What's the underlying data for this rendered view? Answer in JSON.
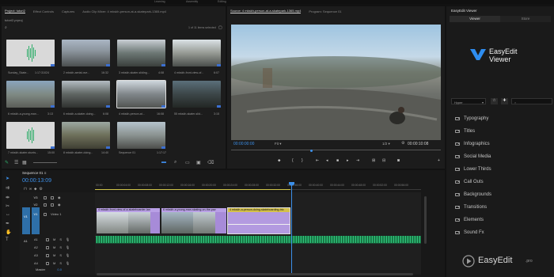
{
  "menubar": [
    "Learning",
    "Assembly",
    "Editing",
    "Color",
    "Effects"
  ],
  "project_panel": {
    "tabs": [
      "Project: tutori2",
      "Effect Controls",
      "Captures",
      "Audio Clip Mixer: 4 mkskh-person-at-a-skatepark-1365.mp4"
    ],
    "bin": "tutori2.prproj",
    "items_selected": "1 of 11 items selected",
    "items": [
      {
        "name": "Sunday_Skate...",
        "dur": "1:17:31024",
        "kind": "audio"
      },
      {
        "name": "2 mkskh-aerial-ove...",
        "dur": "16:32",
        "kind": "video"
      },
      {
        "name": "3 mkskh-skater-sliding...",
        "dur": "4:08",
        "kind": "video"
      },
      {
        "name": "4 mkskh-front-view-of...",
        "dur": "6:07",
        "kind": "video"
      },
      {
        "name": "6 mkskh-a-young-man...",
        "dur": "3:13",
        "kind": "video"
      },
      {
        "name": "6 mkskh-a-skater-doing...",
        "dur": "6:08",
        "kind": "video"
      },
      {
        "name": "4 mkskh-person-at...",
        "dur": "16:08",
        "kind": "video"
      },
      {
        "name": "55 mkskh-skater-slid...",
        "dur": "3:15",
        "kind": "video"
      },
      {
        "name": "7 mkskh-skater-stunts...",
        "dur": "15:00",
        "kind": "audio"
      },
      {
        "name": "8 mkskh-skater-doing...",
        "dur": "14:40",
        "kind": "video"
      },
      {
        "name": "Sequence 01",
        "dur": "1:17:17",
        "kind": "video"
      }
    ]
  },
  "source_monitor": {
    "tabs": [
      "Source: 4 mkskh-person-at-a-skatepark-1365.mp4",
      "Program: Sequence 01"
    ],
    "timecode_in": "00:00:00:00",
    "fit": "Fit",
    "quality": "1/2",
    "timecode_out": "00:00:10:08"
  },
  "timeline": {
    "sequence_tab": "Sequence 01",
    "timecode": "00:00:13:09",
    "ruler": [
      "00:00",
      "00:00:04:00",
      "00:00:08:00",
      "00:00:12:00",
      "00:00:16:00",
      "00:00:20:00",
      "00:00:24:00",
      "00:00:28:00",
      "00:00:32:00",
      "00:00:36:00",
      "00:00:40:00",
      "00:00:44:00",
      "00:00:48:00",
      "00:00:52:00",
      "00:00:56:00"
    ],
    "video_tracks": [
      "V3",
      "V2",
      "V1"
    ],
    "audio_tracks": [
      "A1",
      "A2",
      "A3",
      "A4",
      "A5"
    ],
    "track_name": "Video 1",
    "master": "Master",
    "master_val": "0.0",
    "clips": [
      "4 mkskh-front-view-of-a-skateboarder-lan",
      "6 mkskh-a-young-man-skating-on-the-pav",
      "4 mkskh-a-person-doing-skateboarding-tric"
    ]
  },
  "sidebar": {
    "tabs": [
      "EasyEdit Viewer",
      "Viewer",
      "Store"
    ],
    "logo_line1": "EasyEdit",
    "logo_line2": "Viewer",
    "filter": "Hyper",
    "search_placeholder": "Search",
    "categories": [
      "Typography",
      "Titles",
      "Infographics",
      "Social Media",
      "Lower Thirds",
      "Call Outs",
      "Backgrounds",
      "Transitions",
      "Elements",
      "Sound Fx"
    ]
  },
  "watermark": {
    "brand": "EasyEdit",
    "suffix": ".pro"
  },
  "colors": {
    "accent": "#2e8df0",
    "clip_purple": "#a78bd8",
    "clip_label": "#9a7fd0",
    "audio_green": "#2fc27a"
  }
}
